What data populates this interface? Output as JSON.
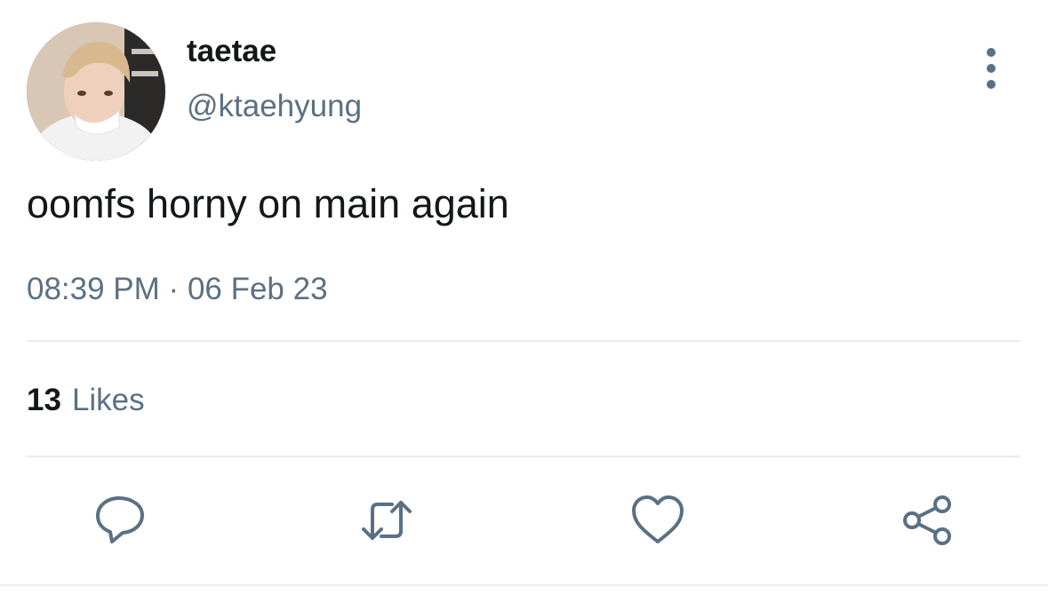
{
  "user": {
    "display_name": "taetae",
    "handle": "@ktaehyung"
  },
  "tweet": {
    "text": "oomfs horny on main again",
    "time": "08:39 PM",
    "separator": "·",
    "date": "06 Feb 23"
  },
  "stats": {
    "likes_count": "13",
    "likes_label": "Likes"
  },
  "actions": {
    "reply_icon": "reply-icon",
    "retweet_icon": "retweet-icon",
    "like_icon": "heart-icon",
    "share_icon": "share-icon"
  },
  "colors": {
    "primary_text": "#14171a",
    "secondary_text": "#5b7083",
    "icon": "#5b7083",
    "divider": "#e6ecf0"
  }
}
